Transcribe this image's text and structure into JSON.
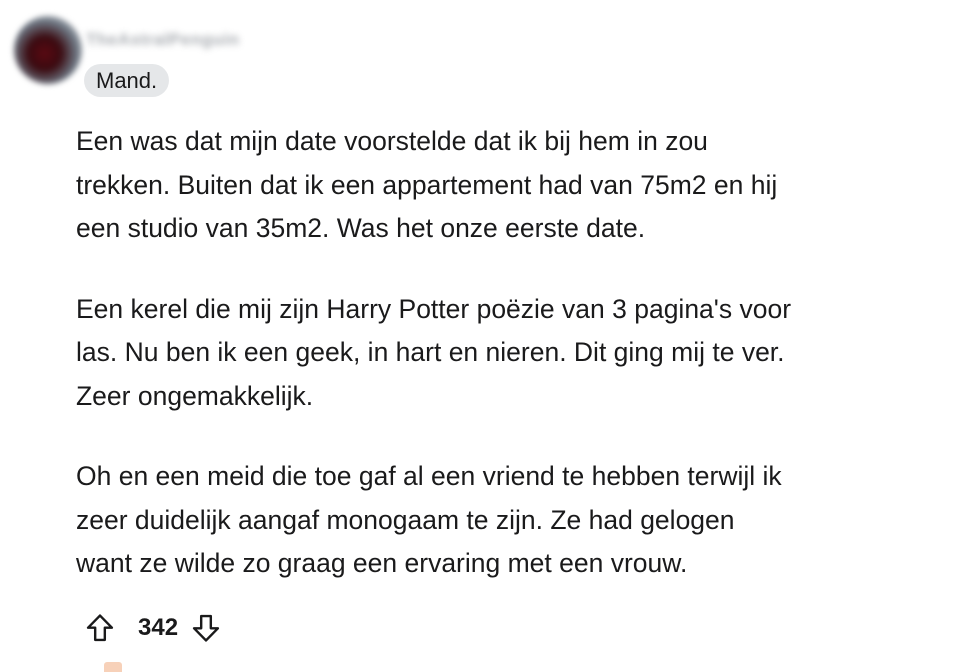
{
  "comment": {
    "username": "TheAstralPenguin",
    "flair": "Mand.",
    "paragraphs": [
      "Een was dat mijn date voorstelde dat ik bij hem in zou\ntrekken. Buiten dat ik een appartement had van 75m2 en hij\neen studio van 35m2. Was het onze eerste date.",
      "Een kerel die mij zijn Harry Potter poëzie van 3 pagina's voor\nlas. Nu ben ik een geek, in hart en nieren. Dit ging mij te ver.\nZeer ongemakkelijk.",
      "Oh en een meid die toe gaf al een vriend te hebben terwijl ik\nzeer duidelijk aangaf monogaam te zijn. Ze had gelogen\nwant ze wilde zo graag een ervaring met een vrouw."
    ],
    "score": "342"
  },
  "icons": {
    "upvote": "arrow-up-outline-icon",
    "downvote": "arrow-down-outline-icon"
  }
}
